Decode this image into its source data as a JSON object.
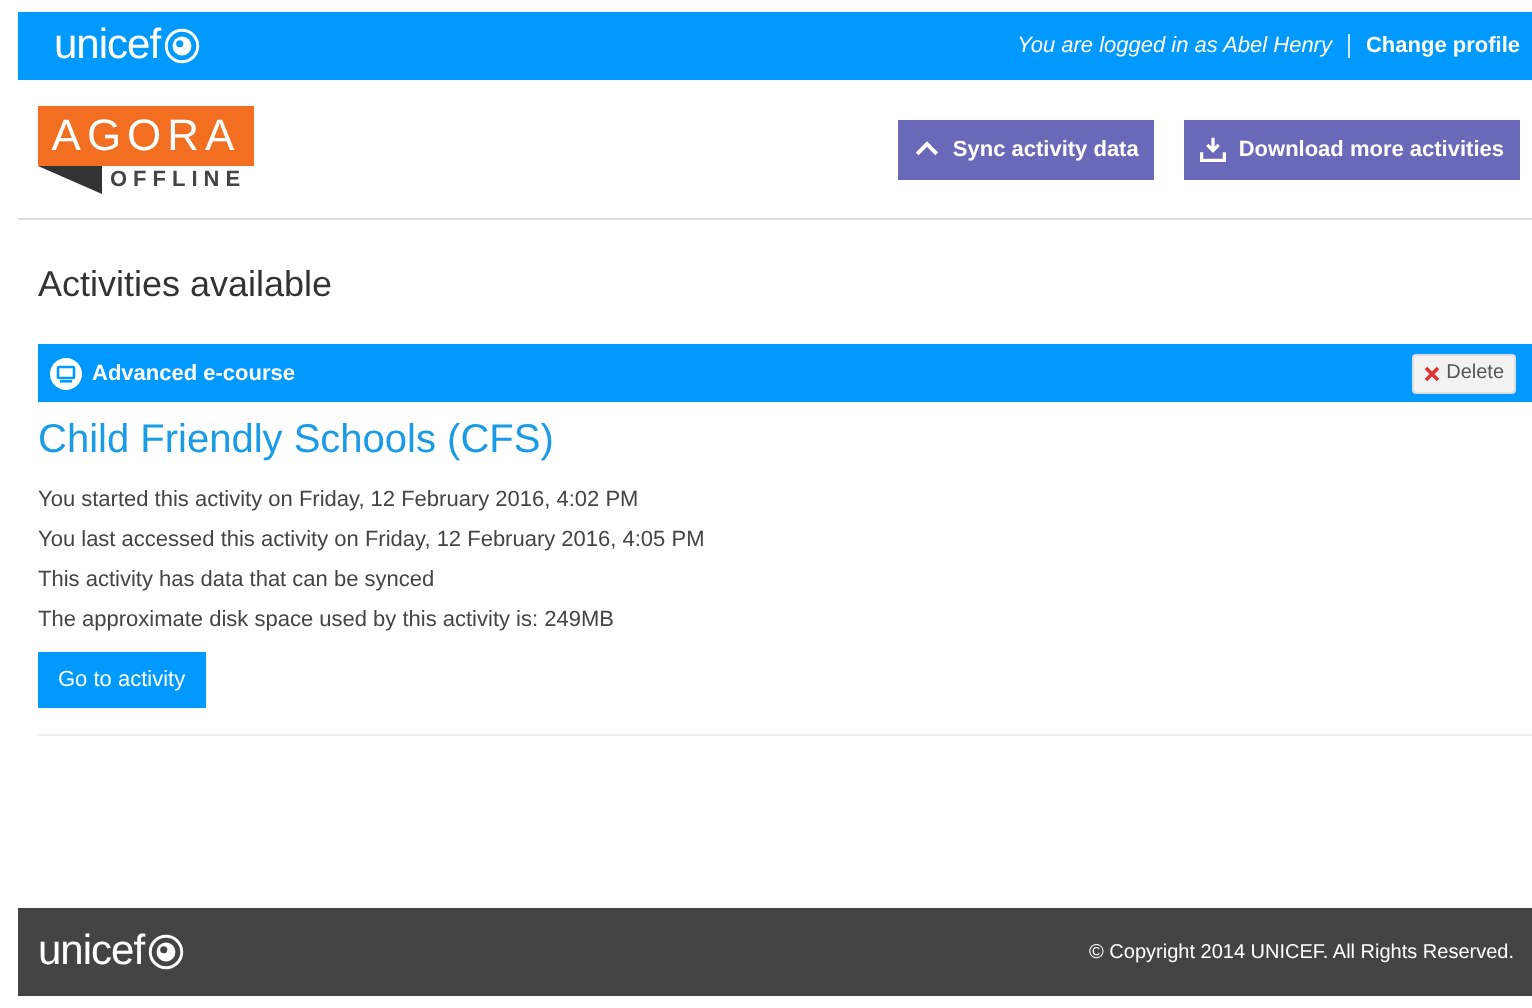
{
  "top_bar": {
    "brand": "unicef",
    "login_text": "You are logged in as Abel Henry",
    "change_profile": "Change profile"
  },
  "header": {
    "logo_top": "AGORA",
    "logo_bottom": "OFFLINE",
    "buttons": [
      {
        "kind": "sync",
        "label": "Sync activity data"
      },
      {
        "kind": "download",
        "label": "Download more activities"
      }
    ]
  },
  "heading": "Activities available",
  "activities": [
    {
      "type": "Advanced e-course",
      "delete": "Delete",
      "title": "Child Friendly Schools (CFS)",
      "details": [
        "You started this activity on Friday, 12 February 2016, 4:02 PM",
        "You last accessed this activity on Friday, 12 February 2016, 4:05 PM",
        "This activity has data that can be synced",
        "The approximate disk space used by this activity is: 249MB"
      ],
      "action": "Go to activity"
    }
  ],
  "footer": {
    "brand": "unicef",
    "copyright": "© Copyright 2014 UNICEF. All Rights Reserved."
  }
}
